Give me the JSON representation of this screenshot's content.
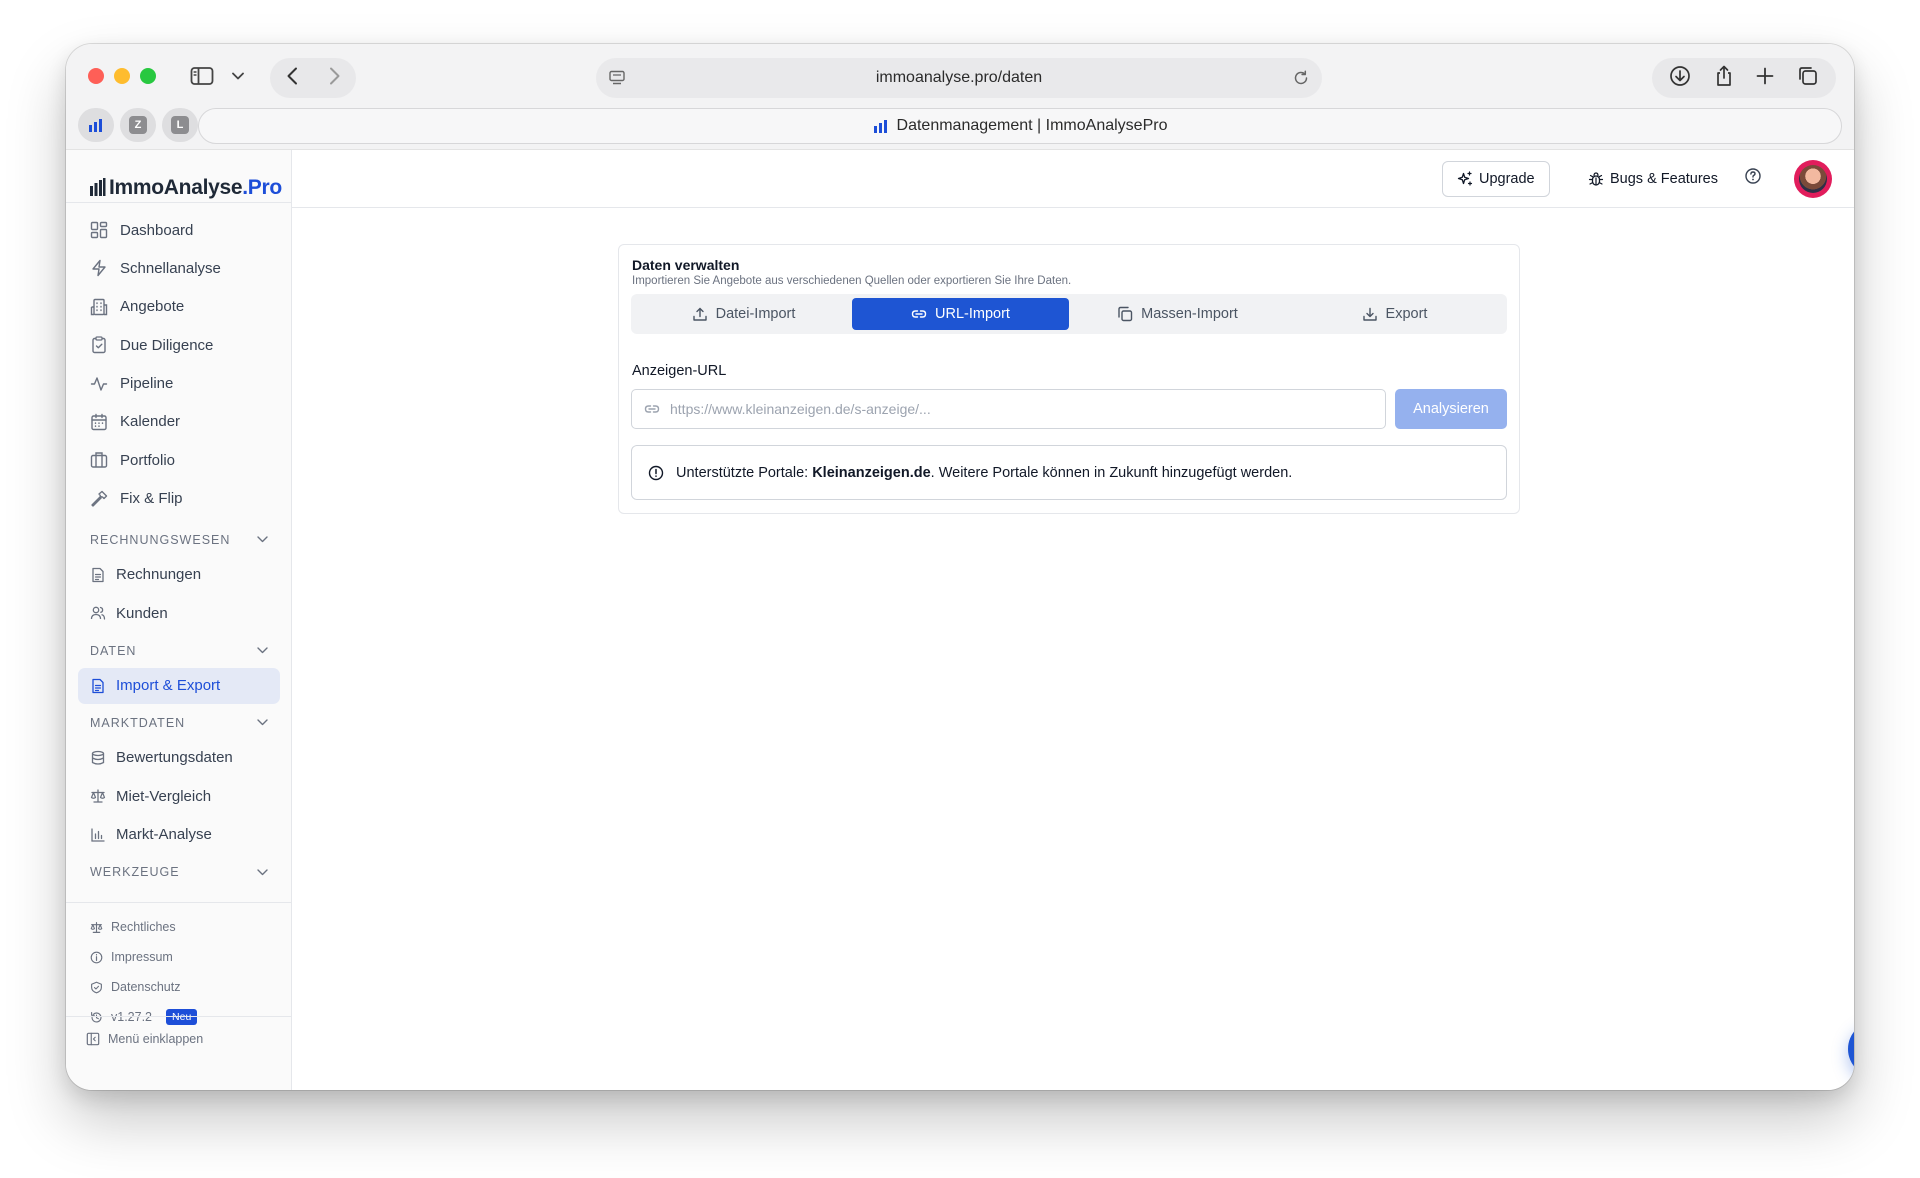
{
  "browser": {
    "url": "immoanalyse.pro/daten",
    "tab_title": "Datenmanagement | ImmoAnalysePro",
    "favorites": [
      "Z",
      "L"
    ]
  },
  "brand": {
    "name_main": "ImmoAnalyse",
    "name_suffix": ".Pro",
    "color": "#1d4ed8"
  },
  "sidebar": {
    "main_items": [
      {
        "label": "Dashboard",
        "icon": "grid-icon"
      },
      {
        "label": "Schnellanalyse",
        "icon": "bolt-icon"
      },
      {
        "label": "Angebote",
        "icon": "building-icon"
      },
      {
        "label": "Due Diligence",
        "icon": "clipboard-icon"
      },
      {
        "label": "Pipeline",
        "icon": "activity-icon"
      },
      {
        "label": "Kalender",
        "icon": "calendar-icon"
      },
      {
        "label": "Portfolio",
        "icon": "briefcase-icon"
      },
      {
        "label": "Fix & Flip",
        "icon": "hammer-icon"
      }
    ],
    "sections": {
      "rechnungswesen": {
        "title": "RECHNUNGSWESEN",
        "items": [
          "Rechnungen",
          "Kunden"
        ]
      },
      "daten": {
        "title": "DATEN",
        "items": [
          "Import & Export"
        ]
      },
      "marktdaten": {
        "title": "MARKTDATEN",
        "items": [
          "Bewertungsdaten",
          "Miet-Vergleich",
          "Markt-Analyse"
        ]
      },
      "werkzeuge": {
        "title": "WERKZEUGE"
      }
    },
    "footer": {
      "rechtliches": "Rechtliches",
      "impressum": "Impressum",
      "datenschutz": "Datenschutz",
      "version": "v1.27.2",
      "new_badge": "Neu",
      "collapse": "Menü einklappen"
    }
  },
  "topbar": {
    "upgrade": "Upgrade",
    "bugs": "Bugs & Features"
  },
  "card": {
    "title": "Daten verwalten",
    "subtitle": "Importieren Sie Angebote aus verschiedenen Quellen oder exportieren Sie Ihre Daten.",
    "tabs": [
      "Datei-Import",
      "URL-Import",
      "Massen-Import",
      "Export"
    ],
    "active_tab": "URL-Import",
    "field_label": "Anzeigen-URL",
    "url_placeholder": "https://www.kleinanzeigen.de/s-anzeige/...",
    "analyze_button": "Analysieren",
    "info": {
      "prefix": "Unterstützte Portale: ",
      "portal": "Kleinanzeigen.de",
      "suffix": ". Weitere Portale können in Zukunft hinzugefügt werden."
    }
  },
  "colors": {
    "accent": "#1e55d3",
    "accent_disabled": "#95b1ee",
    "active_nav_bg": "#e4e9f6"
  }
}
